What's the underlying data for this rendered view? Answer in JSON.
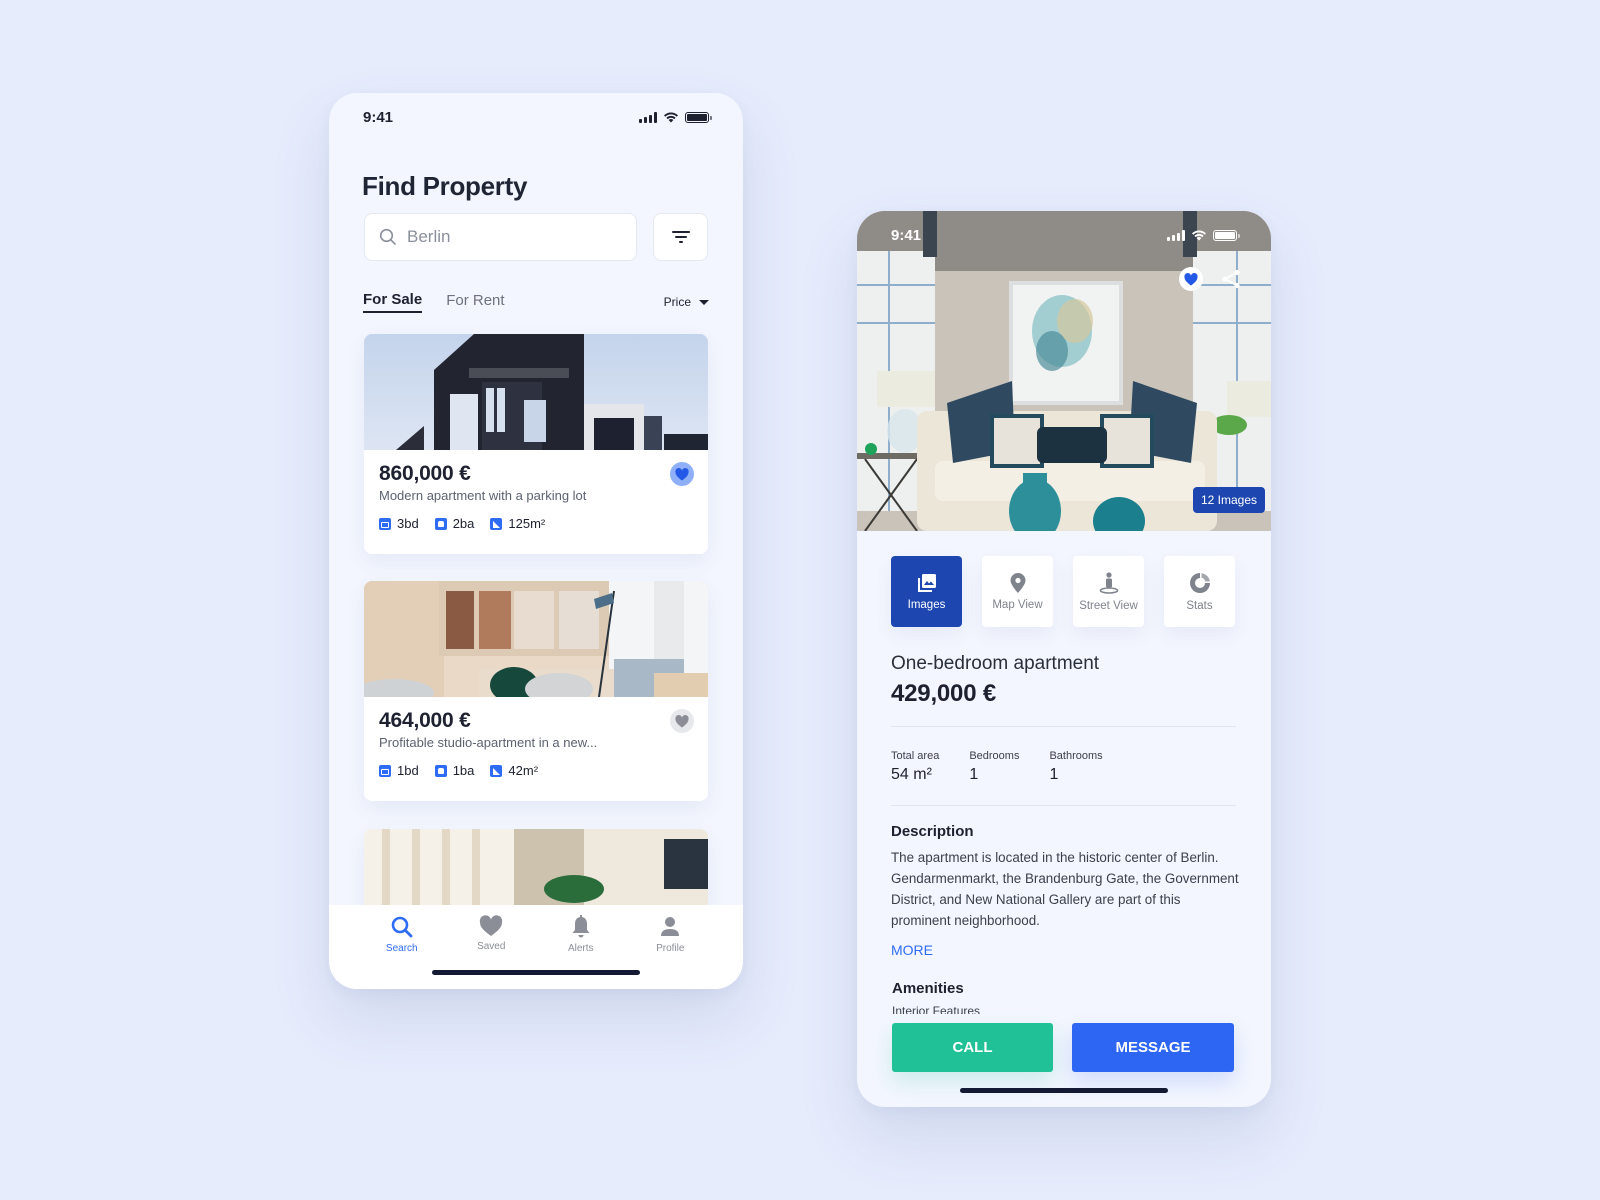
{
  "list_screen": {
    "status_bar": {
      "time": "9:41"
    },
    "title": "Find Property",
    "search": {
      "value": "",
      "placeholder": "Berlin"
    },
    "tabs": [
      {
        "label": "For Sale",
        "active": true
      },
      {
        "label": "For Rent",
        "active": false
      }
    ],
    "sort": {
      "label": "Price"
    },
    "listings": [
      {
        "price": "860,000 €",
        "title": "Modern apartment with a parking lot",
        "bedrooms": "3bd",
        "bathrooms": "2ba",
        "area": "125m²",
        "saved": true,
        "image": "modern-building-exterior"
      },
      {
        "price": "464,000 €",
        "title": "Profitable studio-apartment in a new...",
        "bedrooms": "1bd",
        "bathrooms": "1ba",
        "area": "42m²",
        "saved": false,
        "image": "open-plan-office-living-room"
      },
      {
        "image": "bright-living-room-with-plants"
      }
    ],
    "tab_bar": [
      {
        "label": "Search",
        "icon": "search-icon",
        "active": true
      },
      {
        "label": "Saved",
        "icon": "heart-icon",
        "active": false
      },
      {
        "label": "Alerts",
        "icon": "bell-icon",
        "active": false
      },
      {
        "label": "Profile",
        "icon": "user-icon",
        "active": false
      }
    ]
  },
  "detail_screen": {
    "status_bar": {
      "time": "9:41"
    },
    "hero": {
      "image": "living-room-sofa-teal-vases",
      "image_count": "12 Images",
      "saved": true
    },
    "segments": [
      {
        "label": "Images",
        "icon": "images-icon",
        "active": true
      },
      {
        "label": "Map View",
        "icon": "map-pin-icon",
        "active": false
      },
      {
        "label": "Street View",
        "icon": "street-view-icon",
        "active": false
      },
      {
        "label": "Stats",
        "icon": "stats-icon",
        "active": false
      }
    ],
    "title": "One-bedroom apartment",
    "price": "429,000 €",
    "specs": [
      {
        "label": "Total area",
        "value": "54 m²"
      },
      {
        "label": "Bedrooms",
        "value": "1"
      },
      {
        "label": "Bathrooms",
        "value": "1"
      }
    ],
    "description": {
      "heading": "Description",
      "text": "The apartment is located in the historic center of Berlin. Gendarmenmarkt, the Brandenburg Gate, the Government District, and New National Gallery are part of this prominent neighborhood.",
      "more_label": "MORE"
    },
    "amenities": {
      "heading": "Amenities",
      "subheading": "Interior Features"
    },
    "actions": {
      "call_label": "CALL",
      "message_label": "MESSAGE"
    }
  },
  "colors": {
    "background": "#e6ecfc",
    "accent_blue": "#2f6cf5",
    "dark_blue": "#1d46b0",
    "call_green": "#20c196",
    "text_dark": "#1d2130"
  }
}
